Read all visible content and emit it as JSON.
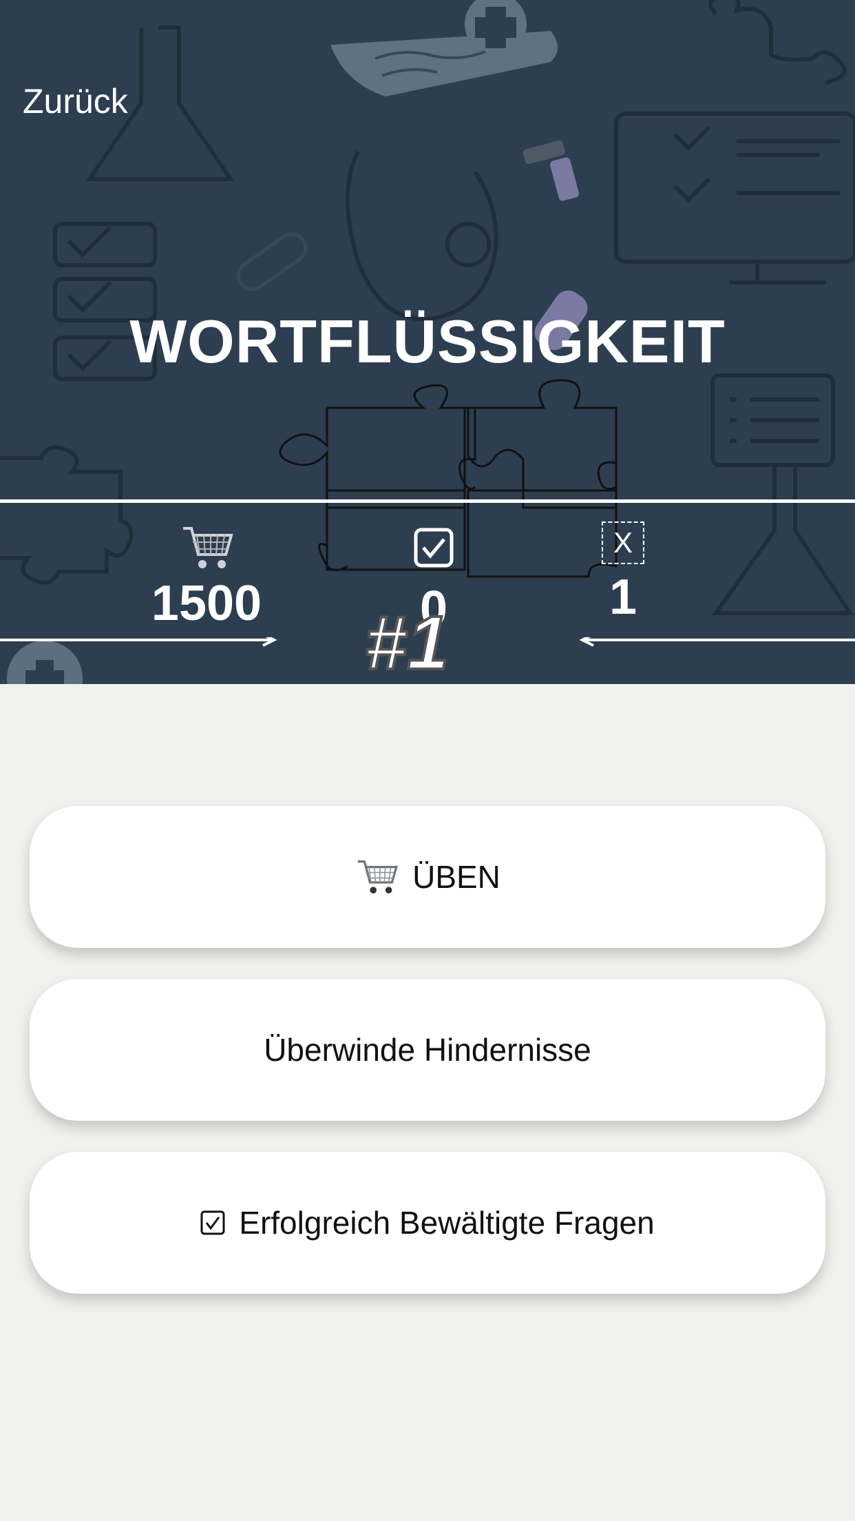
{
  "nav": {
    "back_label": "Zurück"
  },
  "header": {
    "title": "WORTFLÜSSIGKEIT"
  },
  "stats": {
    "practice_count": "1500",
    "correct_count": "0",
    "wrong_count": "1",
    "wrong_icon_text": "X",
    "badge_text": "#1"
  },
  "menu": {
    "practice_label": "ÜBEN",
    "obstacles_label": "Überwinde Hindernisse",
    "solved_label": "Erfolgreich Bewältigte Fragen"
  },
  "colors": {
    "header_bg": "#2d3e50",
    "page_bg": "#f0f0ed",
    "button_bg": "#ffffff"
  },
  "icons": [
    "cart-icon",
    "checkbox-checked-icon",
    "x-box-icon",
    "arrow-left-icon",
    "arrow-right-icon"
  ]
}
